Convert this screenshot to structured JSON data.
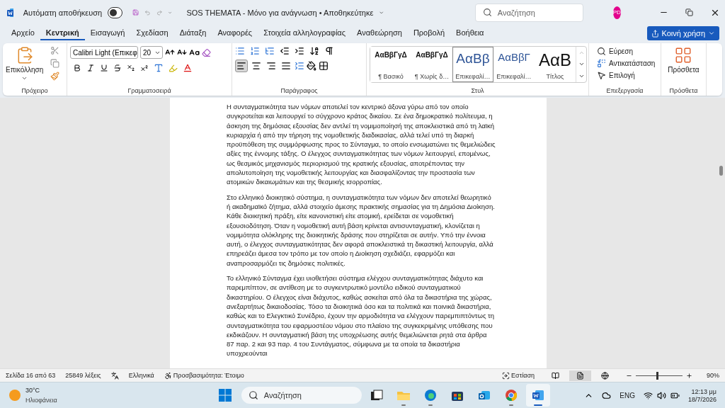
{
  "title_bar": {
    "autosave_label": "Αυτόματη αποθήκευση",
    "autosave_on": false,
    "title": "SOS THEMATA  -  Μόνο για ανάγνωση • Αποθηκεύτηκε",
    "search_placeholder": "Αναζήτηση",
    "avatar": "PD"
  },
  "menu_tabs": [
    {
      "label": "Αρχείο",
      "selected": false
    },
    {
      "label": "Κεντρική",
      "selected": true
    },
    {
      "label": "Εισαγωγή",
      "selected": false
    },
    {
      "label": "Σχεδίαση",
      "selected": false
    },
    {
      "label": "Διάταξη",
      "selected": false
    },
    {
      "label": "Αναφορές",
      "selected": false
    },
    {
      "label": "Στοιχεία αλληλογραφίας",
      "selected": false
    },
    {
      "label": "Αναθεώρηση",
      "selected": false
    },
    {
      "label": "Προβολή",
      "selected": false
    },
    {
      "label": "Βοήθεια",
      "selected": false
    }
  ],
  "share_button": "Κοινή χρήση",
  "ribbon": {
    "clipboard": {
      "paste": "Επικόλληση",
      "label": "Πρόχειρο"
    },
    "font": {
      "name": "Calibri Light (Επικεφ",
      "size": "20",
      "label": "Γραμματοσειρά"
    },
    "paragraph": {
      "label": "Παράγραφος",
      "align": [
        {
          "kind": "left",
          "selected": true
        },
        {
          "kind": "center",
          "selected": false
        },
        {
          "kind": "right",
          "selected": false
        },
        {
          "kind": "justify",
          "selected": false
        }
      ]
    },
    "styles": {
      "label": "Στυλ",
      "items": [
        {
          "preview": "ΑαΒβΓγΔ",
          "name": "¶ Βασικό",
          "kind": "normal",
          "selected": false
        },
        {
          "preview": "ΑαΒβΓγΔ",
          "name": "¶ Χωρίς δ…",
          "kind": "normal",
          "selected": false
        },
        {
          "preview": "ΑαΒβ",
          "name": "Επικεφαλί…",
          "kind": "heading1",
          "selected": true
        },
        {
          "preview": "ΑαΒβΓ",
          "name": "Επικεφαλί…",
          "kind": "heading2",
          "selected": false
        },
        {
          "preview": "ΑαΒ",
          "name": "Τίτλος",
          "kind": "title",
          "selected": false
        }
      ]
    },
    "editing": {
      "label": "Επεξεργασία",
      "items": [
        {
          "kind": "find",
          "label": "Εύρεση"
        },
        {
          "kind": "replace",
          "label": "Αντικατάσταση"
        },
        {
          "kind": "select",
          "label": "Επιλογή"
        }
      ]
    },
    "addins": {
      "button": "Πρόσθετα",
      "label": "Πρόσθετα"
    }
  },
  "document": {
    "paragraphs": [
      "Η συνταγματικότητα των νόμων αποτελεί τον κεντρικό άξονα γύρω από τον οποίο συγκροτείται και λειτουργεί το σύγχρονο κράτος δικαίου. Σε ένα δημοκρατικό πολίτευμα, η άσκηση της δημόσιας εξουσίας δεν αντλεί τη νομιμοποίησή της αποκλειστικά από τη λαϊκή κυριαρχία ή από την τήρηση της νομοθετικής διαδικασίας, αλλά τελεί υπό τη διαρκή προϋπόθεση της συμμόρφωσης προς το Σύνταγμα, το οποίο ενσωματώνει τις θεμελιώδεις αξίες της έννομης τάξης. Ο έλεγχος συνταγματικότητας των νόμων λειτουργεί, επομένως, ως θεσμικός μηχανισμός περιορισμού της κρατικής εξουσίας, αποτρέποντας την απολυτοποίηση της νομοθετικής λειτουργίας και διασφαλίζοντας την προστασία των ατομικών δικαιωμάτων και της θεσμικής ισορροπίας.",
      "Στο ελληνικό διοικητικό σύστημα, η συνταγματικότητα των νόμων δεν αποτελεί θεωρητικό ή ακαδημαϊκό ζήτημα, αλλά στοιχείο άμεσης πρακτικής σημασίας για τη Δημόσια Διοίκηση. Κάθε διοικητική πράξη, είτε κανονιστική είτε ατομική, ερείδεται σε νομοθετική εξουσιοδότηση. Όταν η νομοθετική αυτή βάση κρίνεται αντισυνταγματική, κλονίζεται η νομιμότητα ολόκληρης της διοικητικής δράσης που στηρίζεται σε αυτήν. Υπό την έννοια αυτή, ο έλεγχος συνταγματικότητας δεν αφορά αποκλειστικά τη δικαστική λειτουργία, αλλά επηρεάζει άμεσα τον τρόπο με τον οποίο η Διοίκηση σχεδιάζει, εφαρμόζει και αναπροσαρμόζει τις δημόσιες πολιτικές.",
      "Το ελληνικό Σύνταγμα έχει υιοθετήσει σύστημα ελέγχου συνταγματικότητας διάχυτο και παρεμπίπτον, σε αντίθεση με το συγκεντρωτικό μοντέλο ειδικού συνταγματικού δικαστηρίου. Ο έλεγχος είναι διάχυτος, καθώς ασκείται από όλα τα δικαστήρια της χώρας, ανεξαρτήτως δικαιοδοσίας. Τόσο τα διοικητικά όσο και τα πολιτικά και ποινικά δικαστήρια, καθώς και το Ελεγκτικό Συνέδριο, έχουν την αρμοδιότητα να ελέγχουν παρεμπιπτόντως τη συνταγματικότητα του εφαρμοστέου νόμου στο πλαίσιο της συγκεκριμένης υπόθεσης που εκδικάζουν. Η συνταγματική βάση της υποχρέωσης αυτής θεμελιώνεται ρητά στα άρθρα 87 παρ. 2 και 93 παρ. 4 του Συντάγματος, σύμφωνα με τα οποία τα δικαστήρια υποχρεούνται"
    ]
  },
  "status_bar": {
    "page": "Σελίδα 16 από 63",
    "words": "25849 λέξεις",
    "language": "Ελληνικά",
    "accessibility": "Προσβασιμότητα: Έτοιμο",
    "focus": "Εστίαση",
    "views": [
      {
        "kind": "read",
        "selected": false
      },
      {
        "kind": "print",
        "selected": true
      },
      {
        "kind": "web",
        "selected": false
      }
    ],
    "zoom": {
      "level": 0.45,
      "reading": "90%"
    }
  },
  "taskbar": {
    "temperature": "30°C",
    "condition": "Ηλιοφάνεια",
    "search_placeholder": "Αναζήτηση",
    "apps": [
      {
        "kind": "taskview",
        "running": false,
        "active": false
      },
      {
        "kind": "explorer",
        "running": true,
        "active": false
      },
      {
        "kind": "edge",
        "running": true,
        "active": false
      },
      {
        "kind": "store",
        "running": false,
        "active": false
      },
      {
        "kind": "outlook",
        "running": false,
        "active": false
      },
      {
        "kind": "chrome",
        "running": true,
        "active": false
      },
      {
        "kind": "word",
        "running": true,
        "active": true
      }
    ],
    "language": "ENG",
    "time": "12:13 μμ",
    "date": "18/7/2026"
  }
}
